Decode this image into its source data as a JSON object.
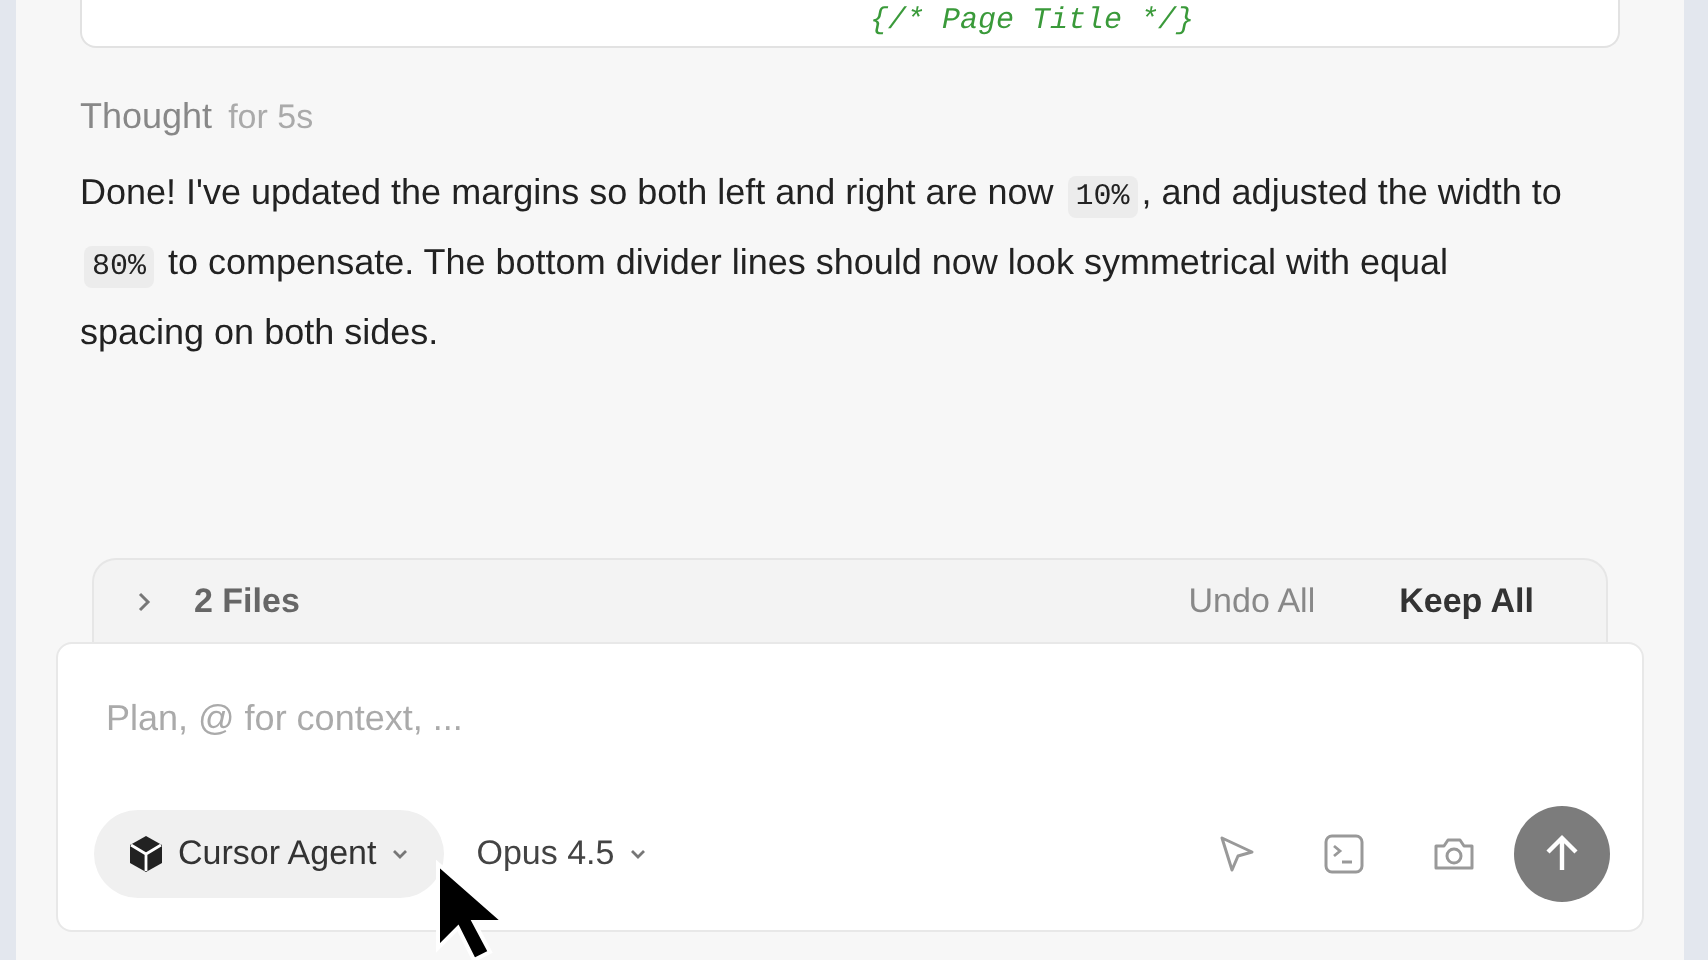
{
  "code_block": {
    "line": "{/* Page Title */}"
  },
  "thought": {
    "label": "Thought",
    "duration": "for 5s"
  },
  "message": [
    {
      "kind": "text",
      "text": "Done! I've updated the margins so both left and right are now "
    },
    {
      "kind": "code",
      "text": "10%"
    },
    {
      "kind": "text",
      "text": ", and adjusted the width to "
    },
    {
      "kind": "code",
      "text": "80%"
    },
    {
      "kind": "text",
      "text": " to compensate. The bottom divider lines should now look symmetrical with equal spacing on both sides."
    }
  ],
  "files_bar": {
    "label": "2 Files",
    "expanded": false,
    "undo": "Undo All",
    "keep": "Keep All"
  },
  "composer": {
    "placeholder": "Plan, @ for context, ...",
    "agent": "Cursor Agent",
    "model": "Opus 4.5"
  }
}
